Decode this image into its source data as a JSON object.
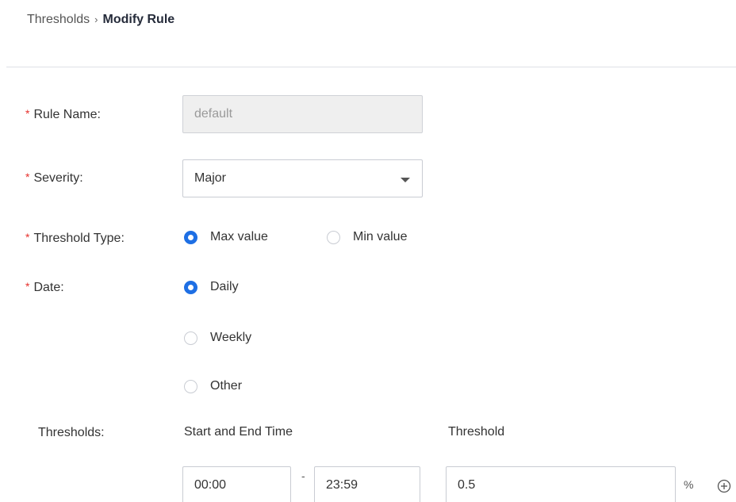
{
  "breadcrumb": {
    "parent": "Thresholds",
    "separator": "›",
    "current": "Modify Rule"
  },
  "form": {
    "required_mark": "*",
    "rule_name": {
      "label": "Rule Name:",
      "value": "default",
      "disabled": true
    },
    "severity": {
      "label": "Severity:",
      "value": "Major"
    },
    "threshold_type": {
      "label": "Threshold Type:",
      "options": [
        {
          "label": "Max value",
          "checked": true
        },
        {
          "label": "Min value",
          "checked": false
        }
      ]
    },
    "date": {
      "label": "Date:",
      "options": [
        {
          "label": "Daily",
          "checked": true
        },
        {
          "label": "Weekly",
          "checked": false
        },
        {
          "label": "Other",
          "checked": false
        }
      ]
    },
    "thresholds": {
      "label": "Thresholds:",
      "col_time": "Start and End Time",
      "col_threshold": "Threshold",
      "rows": [
        {
          "start": "00:00",
          "separator": "-",
          "end": "23:59",
          "threshold": "0.5",
          "unit": "%"
        }
      ]
    }
  },
  "colors": {
    "accent": "#1e6fe4",
    "required": "#e6312c",
    "border": "#c9ccd3",
    "disabled_bg": "#efefef"
  },
  "icons": {
    "severity_dropdown": "caret-down-icon",
    "add_row": "add-circle-icon"
  }
}
